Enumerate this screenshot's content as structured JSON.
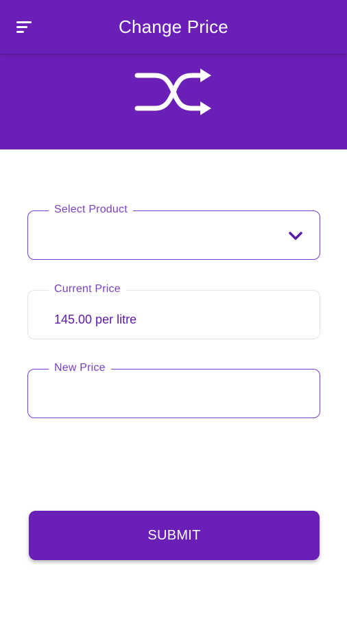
{
  "app_bar": {
    "title": "Change Price",
    "menu_icon": "menu-icon"
  },
  "hero": {
    "icon": "shuffle-icon"
  },
  "form": {
    "select_product": {
      "label": "Select Product",
      "value": "",
      "icon": "chevron-down-icon"
    },
    "current_price": {
      "label": "Current Price",
      "value": "145.00 per litre"
    },
    "new_price": {
      "label": "New Price",
      "value": "",
      "placeholder": ""
    }
  },
  "submit_label": "SUBMIT",
  "colors": {
    "primary": "#6a1fb7",
    "label": "#7a3fc0",
    "value_text": "#5b1aa6",
    "background": "#ffffff"
  }
}
